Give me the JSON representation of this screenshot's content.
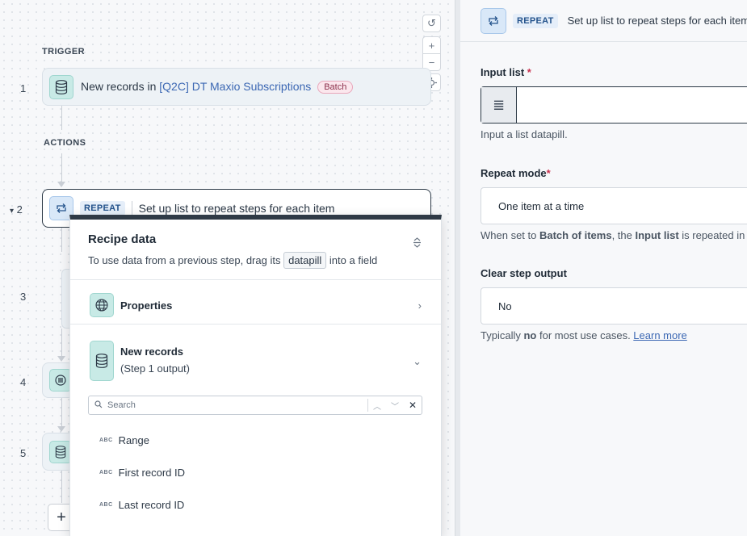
{
  "canvas": {
    "trigger_label": "TRIGGER",
    "actions_label": "ACTIONS",
    "steps": [
      {
        "num": "1",
        "text_prefix": "New records in ",
        "link": "[Q2C] DT Maxio Subscriptions",
        "badge": "Batch"
      },
      {
        "num": "2",
        "type_badge": "REPEAT",
        "text": "Set up list to repeat steps for each item"
      },
      {
        "num": "3"
      },
      {
        "num": "4"
      },
      {
        "num": "5"
      }
    ],
    "collapse_arrow": "▾",
    "add_label": "+"
  },
  "recipe_data": {
    "title": "Recipe data",
    "subtitle_prefix": "To use data from a previous step, drag its",
    "pill": "datapill",
    "subtitle_suffix": "into a field",
    "properties_label": "Properties",
    "new_records_label": "New records",
    "new_records_sub": "(Step 1 output)",
    "search_placeholder": "Search",
    "fields": [
      {
        "type": "ABC",
        "name": "Range"
      },
      {
        "type": "ABC",
        "name": "First record ID"
      },
      {
        "type": "ABC",
        "name": "Last record ID"
      }
    ]
  },
  "panel": {
    "type_badge": "REPEAT",
    "header_text": "Set up list to repeat steps for each item",
    "input_list_label": "Input list",
    "required_mark": "*",
    "input_list_hint": "Input a list datapill.",
    "repeat_mode_label": "Repeat mode",
    "repeat_mode_value": "One item at a time",
    "repeat_hint_prefix": "When set to ",
    "repeat_hint_bold1": "Batch of items",
    "repeat_hint_mid": ", the ",
    "repeat_hint_bold2": "Input list",
    "repeat_hint_suffix": " is repeated in b",
    "clear_output_label": "Clear step output",
    "clear_output_value": "No",
    "clear_hint_prefix": "Typically ",
    "clear_hint_bold": "no",
    "clear_hint_suffix": " for most use cases. ",
    "learn_more": "Learn more"
  },
  "colors": {
    "accent": "#3b67b3",
    "app_icon": "#c8eae6",
    "required": "#c8324f",
    "batch_badge": "#fbe7ed"
  }
}
